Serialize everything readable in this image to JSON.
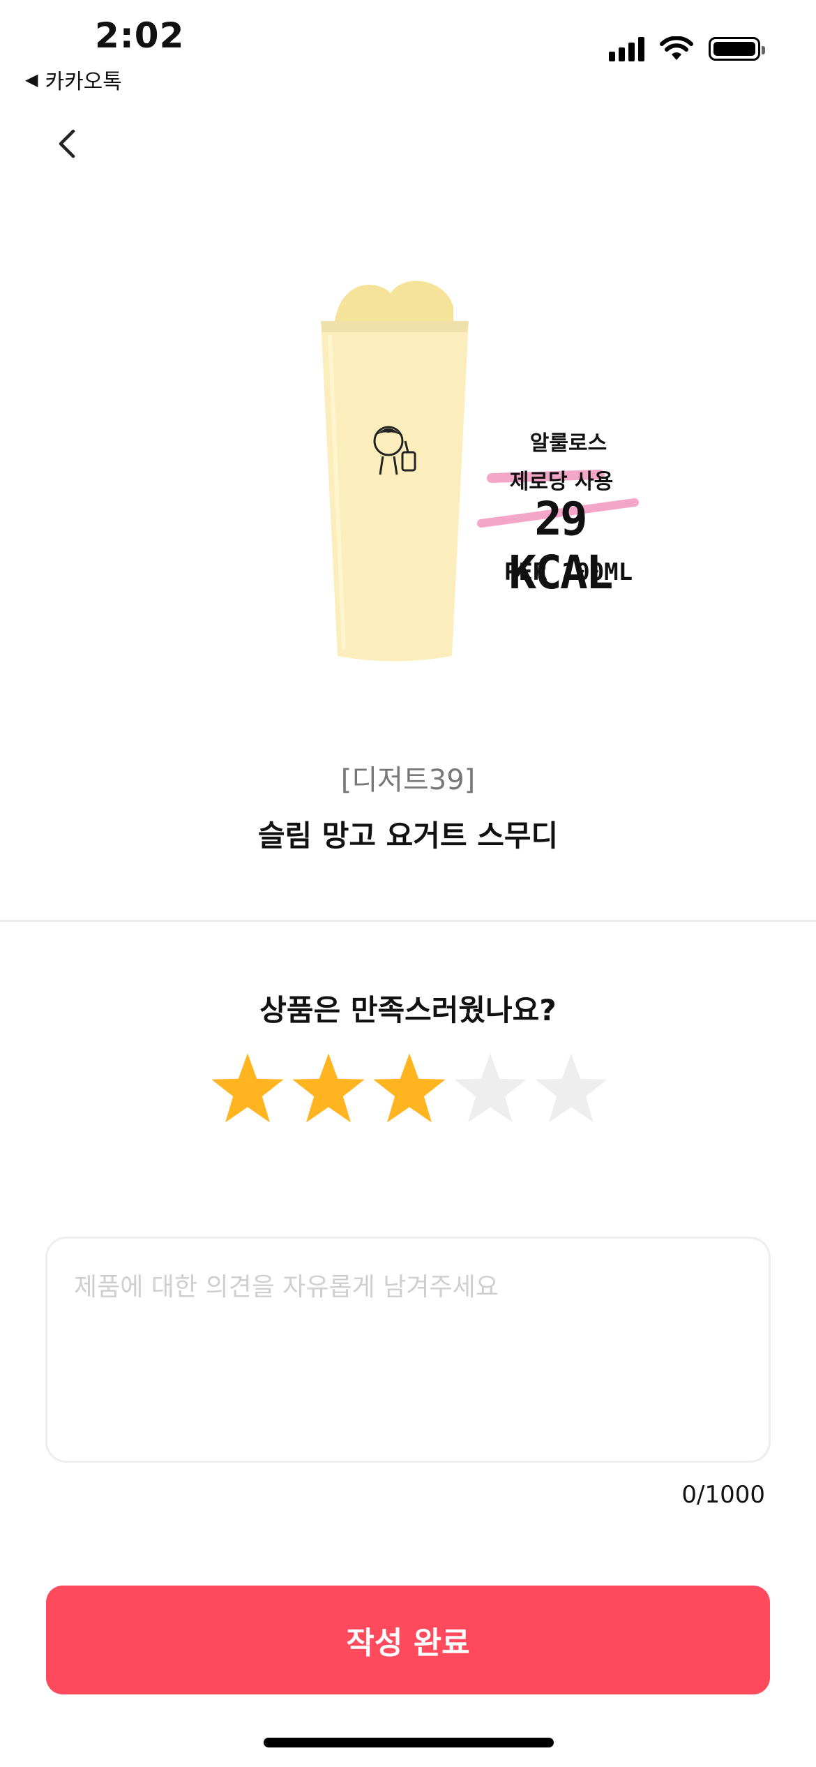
{
  "status_bar": {
    "time": "2:02",
    "back_app_label": "카카오톡"
  },
  "product": {
    "image_badge": {
      "line1": "알룰로스",
      "line2": "제로당 사용",
      "kcal": "29 KCAL",
      "per": "PER 100ML"
    },
    "category": "[디저트39]",
    "name": "슬림 망고 요거트 스무디"
  },
  "review": {
    "question": "상품은 만족스러웠나요?",
    "rating": 3,
    "max_rating": 5,
    "placeholder": "제품에 대한 의견을 자유롭게 남겨주세요",
    "value": "",
    "counter": "0/1000"
  },
  "submit_label": "작성 완료",
  "colors": {
    "accent": "#ff4a5e",
    "star_filled": "#ffb420",
    "star_empty": "#eeeeee",
    "badge_highlight": "#f4a6c8"
  }
}
